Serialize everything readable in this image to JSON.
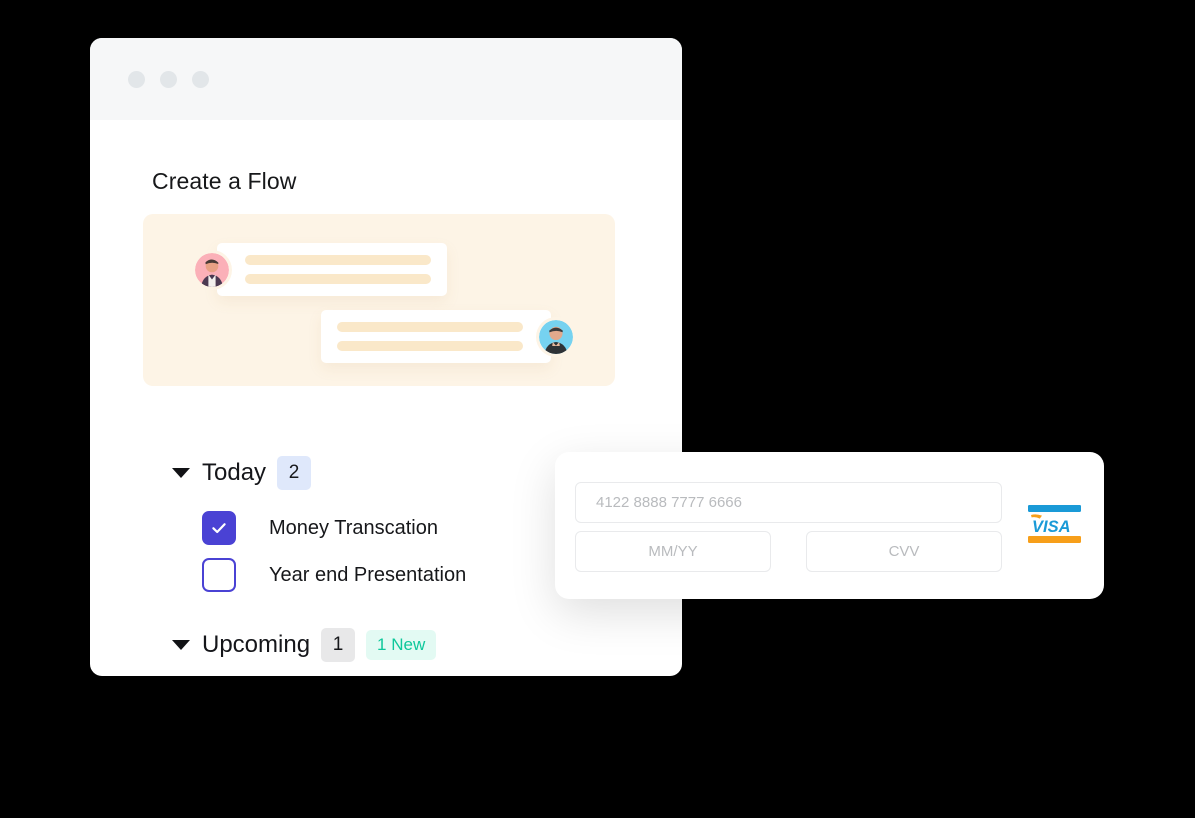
{
  "window": {
    "title": "Create a Flow",
    "traffic_lights": [
      "window-dot-1",
      "window-dot-2",
      "window-dot-3"
    ]
  },
  "chat_preview": {
    "messages": [
      {
        "direction": "incoming",
        "avatar": "avatar-person-pink",
        "lines": 2
      },
      {
        "direction": "outgoing",
        "avatar": "avatar-person-blue",
        "lines": 2
      }
    ]
  },
  "groups": [
    {
      "id": "today",
      "label": "Today",
      "count": "2",
      "count_style": "blue",
      "new_badge": null,
      "expanded": true,
      "tasks": [
        {
          "label": "Money Transcation",
          "checked": true
        },
        {
          "label": "Year end Presentation",
          "checked": false
        }
      ]
    },
    {
      "id": "upcoming",
      "label": "Upcoming",
      "count": "1",
      "count_style": "gray",
      "new_badge": "1 New",
      "expanded": true,
      "tasks": []
    }
  ],
  "payment": {
    "card_number_placeholder": "4122 8888 7777 6666",
    "card_number_value": "",
    "expiry_placeholder": "MM/YY",
    "expiry_value": "",
    "cvv_placeholder": "CVV",
    "cvv_value": "",
    "brand": "VISA"
  },
  "colors": {
    "accent_indigo": "#4a42d4",
    "badge_blue": "#dfe8fb",
    "badge_gray": "#e8e8e9",
    "new_badge_bg": "#e3faf3",
    "new_badge_text": "#0ec89b",
    "chat_card_bg": "#fdf4e6",
    "message_bar": "#fae8c9",
    "titlebar_bg": "#f6f7f8",
    "visa_blue": "#1a9ad7",
    "visa_orange": "#f79f1a"
  }
}
